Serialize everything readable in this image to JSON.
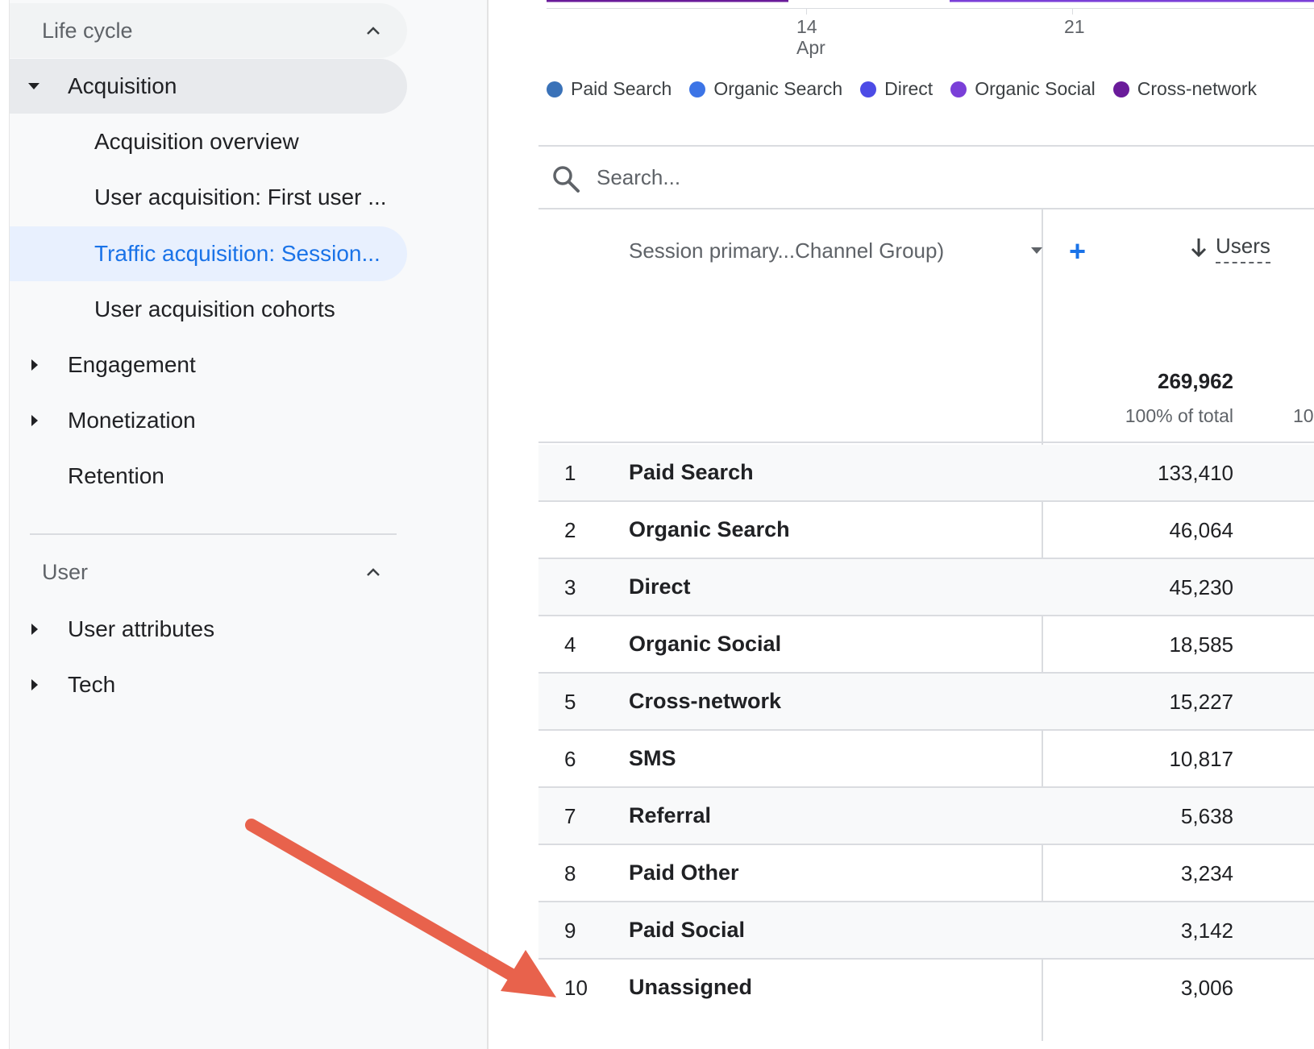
{
  "sidebar": {
    "lifecycle_header": "Life cycle",
    "user_header": "User",
    "items": [
      {
        "label": "Acquisition"
      },
      {
        "label": "Acquisition overview"
      },
      {
        "label": "User acquisition: First user ..."
      },
      {
        "label": "Traffic acquisition: Session..."
      },
      {
        "label": "User acquisition cohorts"
      },
      {
        "label": "Engagement"
      },
      {
        "label": "Monetization"
      },
      {
        "label": "Retention"
      },
      {
        "label": "User attributes"
      },
      {
        "label": "Tech"
      }
    ]
  },
  "chart": {
    "tick_14": "14",
    "tick_14_month": "Apr",
    "tick_21": "21",
    "legend": [
      {
        "label": "Paid Search",
        "color": "#3a72b8"
      },
      {
        "label": "Organic Search",
        "color": "#3c74e6"
      },
      {
        "label": "Direct",
        "color": "#4c4be6"
      },
      {
        "label": "Organic Social",
        "color": "#7a3fd8"
      },
      {
        "label": "Cross-network",
        "color": "#6a1b9a"
      }
    ]
  },
  "search": {
    "placeholder": "Search..."
  },
  "table": {
    "dimension_label": "Session primary...Channel Group)",
    "metric_label": "Users",
    "total": "269,962",
    "total_pct": "100% of total",
    "next_col_partial": "10",
    "rows": [
      {
        "rank": "1",
        "name": "Paid Search",
        "value": "133,410"
      },
      {
        "rank": "2",
        "name": "Organic Search",
        "value": "46,064"
      },
      {
        "rank": "3",
        "name": "Direct",
        "value": "45,230"
      },
      {
        "rank": "4",
        "name": "Organic Social",
        "value": "18,585"
      },
      {
        "rank": "5",
        "name": "Cross-network",
        "value": "15,227"
      },
      {
        "rank": "6",
        "name": "SMS",
        "value": "10,817"
      },
      {
        "rank": "7",
        "name": "Referral",
        "value": "5,638"
      },
      {
        "rank": "8",
        "name": "Paid Other",
        "value": "3,234"
      },
      {
        "rank": "9",
        "name": "Paid Social",
        "value": "3,142"
      },
      {
        "rank": "10",
        "name": "Unassigned",
        "value": "3,006"
      }
    ]
  },
  "colors": {
    "accent": "#1a73e8",
    "annotation_arrow": "#e8624c"
  }
}
